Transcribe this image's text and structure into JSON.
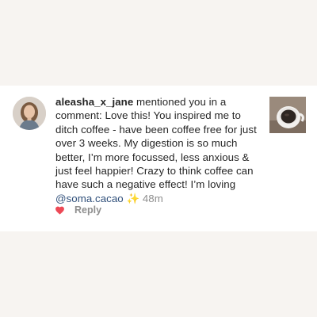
{
  "notification": {
    "username": "aleasha_x_jane",
    "action_text": " mentioned you in a comment: ",
    "comment_text": "Love this! You inspired me to ditch coffee - have been coffee free for just over 3 weeks. My digestion is so much better, I’m more focussed, less anxious & just feel happier! Crazy to think coffee can have such a negative effect! I’m loving ",
    "mention": "@soma.cacao",
    "emoji": " ✨ ",
    "time": "48m",
    "reply_label": "Reply"
  },
  "icons": {
    "avatar": "profile-photo",
    "like": "heart-icon",
    "post_thumbnail": "coffee-cup-photo"
  },
  "colors": {
    "heart": "#ed4956",
    "mention": "#2f4f7a",
    "muted": "#8e8e8e",
    "text": "#262626",
    "background": "#f7f4f1",
    "card": "#ffffff"
  }
}
